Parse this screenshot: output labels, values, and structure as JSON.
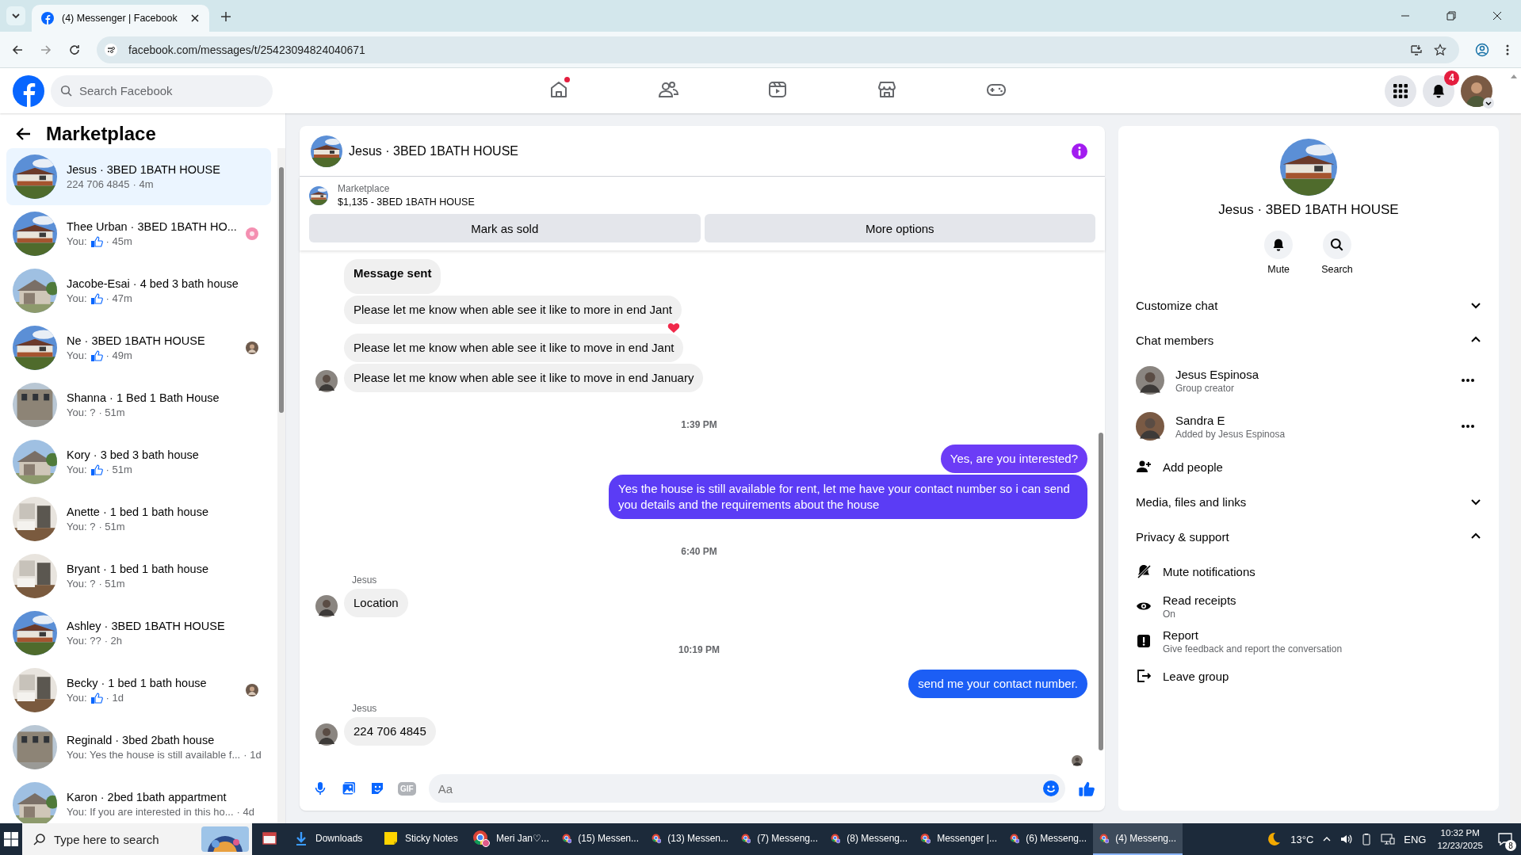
{
  "browser": {
    "tab_title": "(4) Messenger | Facebook",
    "url": "facebook.com/messages/t/25423094824040671"
  },
  "header": {
    "search_placeholder": "Search Facebook",
    "nav": [
      {
        "kind": "home",
        "selected": false,
        "dot": true
      },
      {
        "kind": "friends",
        "selected": false,
        "dot": false
      },
      {
        "kind": "video",
        "selected": false,
        "dot": false
      },
      {
        "kind": "marketplace",
        "selected": false,
        "dot": false
      },
      {
        "kind": "gaming",
        "selected": false,
        "dot": false
      }
    ],
    "notification_count": "4"
  },
  "sidebar": {
    "title": "Marketplace",
    "conversations": [
      {
        "name": "Jesus · 3BED 1BATH HOUSE",
        "preview": "224 706 4845",
        "like": false,
        "time": "· 4m",
        "selected": true
      },
      {
        "name": "Thee Urban · 3BED 1BATH HO...",
        "preview": "You:",
        "like": true,
        "time": "· 45m",
        "selected": false,
        "receipt": {
          "kind": "sticker"
        }
      },
      {
        "name": "Jacobe-Esai · 4 bed 3 bath house",
        "preview": "You:",
        "like": true,
        "time": "· 47m",
        "selected": false
      },
      {
        "name": "Ne · 3BED 1BATH HOUSE",
        "preview": "You:",
        "like": true,
        "time": "· 49m",
        "selected": false,
        "receipt": {
          "kind": "avatar"
        }
      },
      {
        "name": "Shanna · 1 Bed 1 Bath House",
        "preview": "You: ?",
        "like": false,
        "time": "· 51m",
        "selected": false
      },
      {
        "name": "Kory · 3 bed 3 bath house",
        "preview": "You:",
        "like": true,
        "time": "· 51m",
        "selected": false
      },
      {
        "name": "Anette · 1 bed 1 bath house",
        "preview": "You: ?",
        "like": false,
        "time": "· 51m",
        "selected": false
      },
      {
        "name": "Bryant · 1 bed 1 bath house",
        "preview": "You: ?",
        "like": false,
        "time": "· 51m",
        "selected": false
      },
      {
        "name": "Ashley · 3BED 1BATH HOUSE",
        "preview": "You: ??",
        "like": false,
        "time": "· 2h",
        "selected": false
      },
      {
        "name": "Becky · 1 bed 1 bath house",
        "preview": "You:",
        "like": true,
        "time": "· 1d",
        "selected": false,
        "receipt": {
          "kind": "avatar"
        }
      },
      {
        "name": "Reginald · 3bed 2bath house",
        "preview": "You: Yes the house is still available f...",
        "like": false,
        "time": "· 1d",
        "selected": false
      },
      {
        "name": "Karon · 2bed 1bath appartment",
        "preview": "You: If you are interested in this ho...",
        "like": false,
        "time": "· 4d",
        "selected": false
      }
    ]
  },
  "chat": {
    "title": "Jesus · 3BED 1BATH HOUSE",
    "listing_label": "Marketplace",
    "listing": "$1,135 - 3BED 1BATH HOUSE",
    "buttons": [
      "Mark as sold",
      "More options"
    ],
    "messages": [
      {
        "kind": "incoming",
        "text": "Message sent",
        "bold": true,
        "avatar": false,
        "reaction": false
      },
      {
        "kind": "incoming",
        "text": "Please let me know when able see it like to more in end Jant",
        "bold": false,
        "avatar": false,
        "reaction": true
      },
      {
        "kind": "incoming",
        "text": "Please let me know when able see it like to move in end Jant",
        "bold": false,
        "avatar": false,
        "reaction": false
      },
      {
        "kind": "incoming",
        "text": "Please let me know when able see it like to move in end January",
        "bold": false,
        "avatar": true,
        "reaction": false
      },
      {
        "kind": "time",
        "text": "1:39 PM"
      },
      {
        "kind": "outgoing",
        "text": "Yes, are you interested?",
        "color": "#6c3cf6"
      },
      {
        "kind": "outgoing",
        "text": "Yes the house is still available for rent, let me have your contact number so i can send you details and the requirements about the house",
        "color": "#5b3cf5"
      },
      {
        "kind": "time",
        "text": "6:40 PM"
      },
      {
        "kind": "incoming",
        "sender": "Jesus",
        "text": "Location",
        "bold": false,
        "avatar": true,
        "reaction": false
      },
      {
        "kind": "time",
        "text": "10:19 PM"
      },
      {
        "kind": "outgoing",
        "text": "send me your contact number.",
        "color": "#1c5ef5"
      },
      {
        "kind": "incoming",
        "sender": "Jesus",
        "text": "224 706 4845",
        "bold": false,
        "avatar": true,
        "reaction": false
      }
    ],
    "seen": true,
    "composer": {
      "placeholder": "Aa",
      "gif": "GIF"
    }
  },
  "details": {
    "title": "Jesus · 3BED 1BATH HOUSE",
    "actions": [
      {
        "kind": "mute",
        "label": "Mute"
      },
      {
        "kind": "search",
        "label": "Search"
      }
    ],
    "sections": [
      {
        "title": "Customize chat",
        "expanded": false
      },
      {
        "title": "Chat members",
        "expanded": true,
        "items": [
          {
            "kind": "member",
            "name": "Jesus Espinosa",
            "sub": "Group creator"
          },
          {
            "kind": "member",
            "name": "Sandra E",
            "sub": "Added by Jesus Espinosa"
          },
          {
            "kind": "add",
            "name": "Add people"
          }
        ]
      },
      {
        "title": "Media, files and links",
        "expanded": false
      },
      {
        "title": "Privacy & support",
        "expanded": true,
        "items": [
          {
            "kind": "mute",
            "name": "Mute notifications"
          },
          {
            "kind": "receipts",
            "name": "Read receipts",
            "sub": "On"
          },
          {
            "kind": "report",
            "name": "Report",
            "sub": "Give feedback and report the conversation"
          },
          {
            "kind": "leave",
            "name": "Leave group"
          }
        ]
      }
    ]
  },
  "taskbar": {
    "search_placeholder": "Type here to search",
    "apps": [
      {
        "kind": "window",
        "selected": false
      },
      {
        "kind": "download",
        "label": "Downloads",
        "selected": false
      },
      {
        "kind": "notes",
        "label": "Sticky Notes",
        "selected": false
      },
      {
        "kind": "chrome",
        "label": "Meri Jan♡...",
        "selected": false
      },
      {
        "kind": "messenger",
        "label": "(15) Messen...",
        "selected": false
      },
      {
        "kind": "messenger",
        "label": "(13) Messen...",
        "selected": false
      },
      {
        "kind": "messenger",
        "label": "(7) Messeng...",
        "selected": false
      },
      {
        "kind": "messenger",
        "label": "(8) Messeng...",
        "selected": false
      },
      {
        "kind": "messenger",
        "label": "Messenger |...",
        "selected": false
      },
      {
        "kind": "messenger",
        "label": "(6) Messeng...",
        "selected": false
      },
      {
        "kind": "messenger",
        "label": "(4) Messeng...",
        "selected": true
      }
    ],
    "temperature": "13°C",
    "language": "ENG",
    "time": "10:32 PM",
    "date": "12/23/2025",
    "notification_count": "8"
  }
}
